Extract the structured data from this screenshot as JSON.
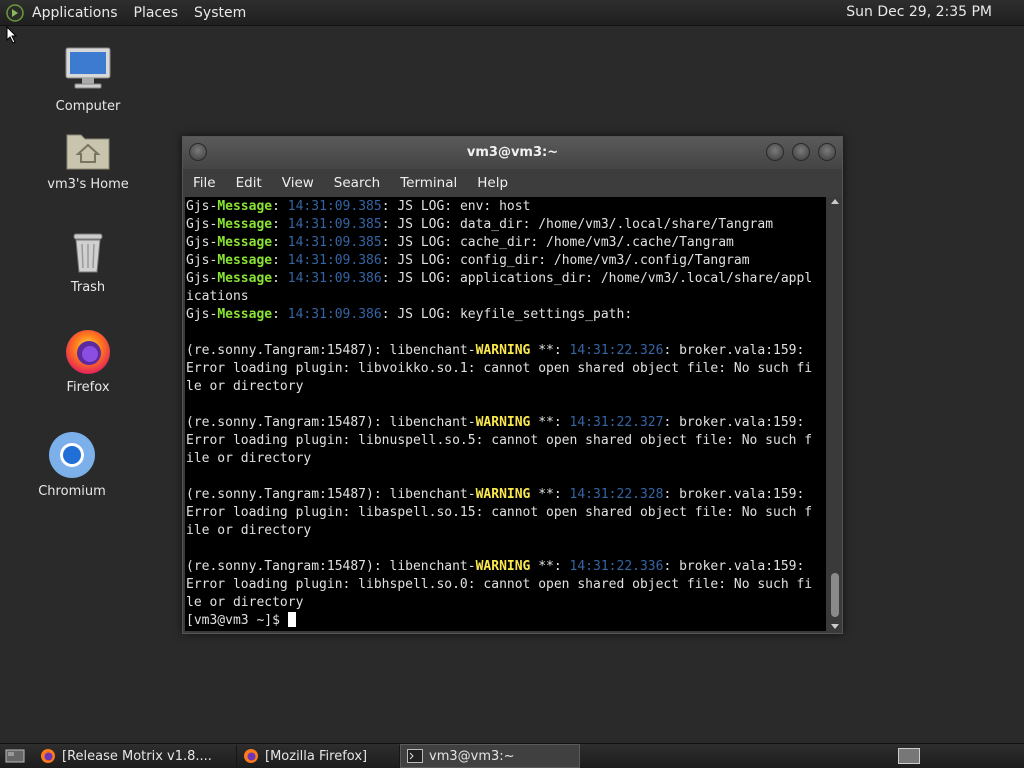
{
  "top_panel": {
    "menus": [
      "Applications",
      "Places",
      "System"
    ],
    "clock": "Sun Dec 29,  2:35 PM"
  },
  "desktop": {
    "icons": [
      {
        "label": "Computer",
        "icon": "computer-icon"
      },
      {
        "label": "vm3's Home",
        "icon": "home-folder-icon"
      },
      {
        "label": "Trash",
        "icon": "trash-icon"
      },
      {
        "label": "Firefox",
        "icon": "firefox-icon"
      },
      {
        "label": "Chromium",
        "icon": "chromium-icon"
      }
    ]
  },
  "terminal": {
    "title": "vm3@vm3:~",
    "menus": [
      "File",
      "Edit",
      "View",
      "Search",
      "Terminal",
      "Help"
    ],
    "lines": [
      [
        {
          "t": "Gjs-"
        },
        {
          "t": "Message",
          "c": "g"
        },
        {
          "t": ": "
        },
        {
          "t": "14:31:09.385",
          "c": "b"
        },
        {
          "t": ": JS LOG: env: host"
        }
      ],
      [
        {
          "t": "Gjs-"
        },
        {
          "t": "Message",
          "c": "g"
        },
        {
          "t": ": "
        },
        {
          "t": "14:31:09.385",
          "c": "b"
        },
        {
          "t": ": JS LOG: data_dir: /home/vm3/.local/share/Tangram"
        }
      ],
      [
        {
          "t": "Gjs-"
        },
        {
          "t": "Message",
          "c": "g"
        },
        {
          "t": ": "
        },
        {
          "t": "14:31:09.385",
          "c": "b"
        },
        {
          "t": ": JS LOG: cache_dir: /home/vm3/.cache/Tangram"
        }
      ],
      [
        {
          "t": "Gjs-"
        },
        {
          "t": "Message",
          "c": "g"
        },
        {
          "t": ": "
        },
        {
          "t": "14:31:09.386",
          "c": "b"
        },
        {
          "t": ": JS LOG: config_dir: /home/vm3/.config/Tangram"
        }
      ],
      [
        {
          "t": "Gjs-"
        },
        {
          "t": "Message",
          "c": "g"
        },
        {
          "t": ": "
        },
        {
          "t": "14:31:09.386",
          "c": "b"
        },
        {
          "t": ": JS LOG: applications_dir: /home/vm3/.local/share/appl"
        }
      ],
      [
        {
          "t": "ications"
        }
      ],
      [
        {
          "t": "Gjs-"
        },
        {
          "t": "Message",
          "c": "g"
        },
        {
          "t": ": "
        },
        {
          "t": "14:31:09.386",
          "c": "b"
        },
        {
          "t": ": JS LOG: keyfile_settings_path:"
        }
      ],
      [
        {
          "t": ""
        }
      ],
      [
        {
          "t": "(re.sonny.Tangram:15487): libenchant-"
        },
        {
          "t": "WARNING",
          "c": "y"
        },
        {
          "t": " **: "
        },
        {
          "t": "14:31:22.326",
          "c": "b"
        },
        {
          "t": ": broker.vala:159:"
        }
      ],
      [
        {
          "t": "Error loading plugin: libvoikko.so.1: cannot open shared object file: No such fi"
        }
      ],
      [
        {
          "t": "le or directory"
        }
      ],
      [
        {
          "t": ""
        }
      ],
      [
        {
          "t": "(re.sonny.Tangram:15487): libenchant-"
        },
        {
          "t": "WARNING",
          "c": "y"
        },
        {
          "t": " **: "
        },
        {
          "t": "14:31:22.327",
          "c": "b"
        },
        {
          "t": ": broker.vala:159:"
        }
      ],
      [
        {
          "t": "Error loading plugin: libnuspell.so.5: cannot open shared object file: No such f"
        }
      ],
      [
        {
          "t": "ile or directory"
        }
      ],
      [
        {
          "t": ""
        }
      ],
      [
        {
          "t": "(re.sonny.Tangram:15487): libenchant-"
        },
        {
          "t": "WARNING",
          "c": "y"
        },
        {
          "t": " **: "
        },
        {
          "t": "14:31:22.328",
          "c": "b"
        },
        {
          "t": ": broker.vala:159:"
        }
      ],
      [
        {
          "t": "Error loading plugin: libaspell.so.15: cannot open shared object file: No such f"
        }
      ],
      [
        {
          "t": "ile or directory"
        }
      ],
      [
        {
          "t": ""
        }
      ],
      [
        {
          "t": "(re.sonny.Tangram:15487): libenchant-"
        },
        {
          "t": "WARNING",
          "c": "y"
        },
        {
          "t": " **: "
        },
        {
          "t": "14:31:22.336",
          "c": "b"
        },
        {
          "t": ": broker.vala:159:"
        }
      ],
      [
        {
          "t": "Error loading plugin: libhspell.so.0: cannot open shared object file: No such fi"
        }
      ],
      [
        {
          "t": "le or directory"
        }
      ]
    ],
    "prompt": "[vm3@vm3 ~]$ "
  },
  "taskbar": {
    "tasks": [
      {
        "label": "[Release Motrix v1.8....",
        "icon": "firefox-icon",
        "active": false
      },
      {
        "label": "[Mozilla Firefox]",
        "icon": "firefox-icon",
        "active": false
      },
      {
        "label": "vm3@vm3:~",
        "icon": "terminal-icon",
        "active": true
      }
    ]
  },
  "colors": {
    "message_green": "#8ae234",
    "warning_yellow": "#fce94f",
    "timestamp_blue": "#3465a4"
  }
}
